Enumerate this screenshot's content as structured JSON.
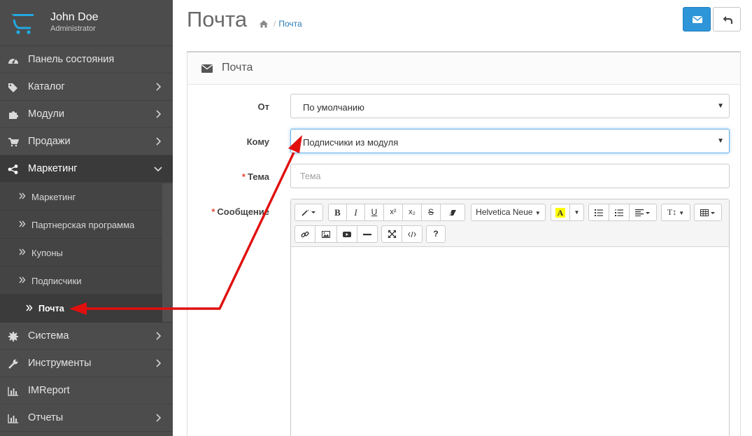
{
  "sidebar": {
    "user_name": "John Doe",
    "user_role": "Administrator",
    "items": [
      {
        "label": "Панель состояния",
        "icon": "dashboard-icon",
        "arrow": false
      },
      {
        "label": "Каталог",
        "icon": "tags-icon",
        "arrow": true
      },
      {
        "label": "Модули",
        "icon": "puzzle-icon",
        "arrow": true
      },
      {
        "label": "Продажи",
        "icon": "cart-icon",
        "arrow": true
      },
      {
        "label": "Маркетинг",
        "icon": "share-icon",
        "arrow": true,
        "expanded": true
      },
      {
        "label": "Система",
        "icon": "gear-icon",
        "arrow": true
      },
      {
        "label": "Инструменты",
        "icon": "wrench-icon",
        "arrow": true
      },
      {
        "label": "IMReport",
        "icon": "bar-chart-icon",
        "arrow": false
      },
      {
        "label": "Отчеты",
        "icon": "bar-chart-icon",
        "arrow": true
      }
    ],
    "marketing_submenu": [
      {
        "label": "Маркетинг"
      },
      {
        "label": "Партнерская программа"
      },
      {
        "label": "Купоны"
      },
      {
        "label": "Подписчики"
      },
      {
        "label": "Почта",
        "current": true
      }
    ]
  },
  "header": {
    "title": "Почта",
    "breadcrumb": [
      "Почта"
    ]
  },
  "panel": {
    "title": "Почта",
    "fields": {
      "from_label": "От",
      "from_value": "По умолчанию",
      "to_label": "Кому",
      "to_value": "Подписчики из модуля",
      "subject_label": "Тема",
      "subject_placeholder": "Тема",
      "message_label": "Сообщение"
    },
    "editor": {
      "font_name": "Helvetica Neue",
      "buttons_row1": [
        "magic-icon",
        "bold",
        "italic",
        "underline",
        "superscript",
        "subscript",
        "strikethrough",
        "eraser-icon",
        "font-name",
        "text-color",
        "unordered-list",
        "ordered-list",
        "align",
        "line-height",
        "table"
      ],
      "buttons_row2": [
        "link-icon",
        "image-icon",
        "video-icon",
        "hr-icon",
        "fullscreen-icon",
        "code-icon",
        "help"
      ]
    }
  },
  "colors": {
    "sidebar_bg": "#4c4c4c",
    "accent_blue": "#2e95d8",
    "annotation_red": "#e0100f"
  }
}
